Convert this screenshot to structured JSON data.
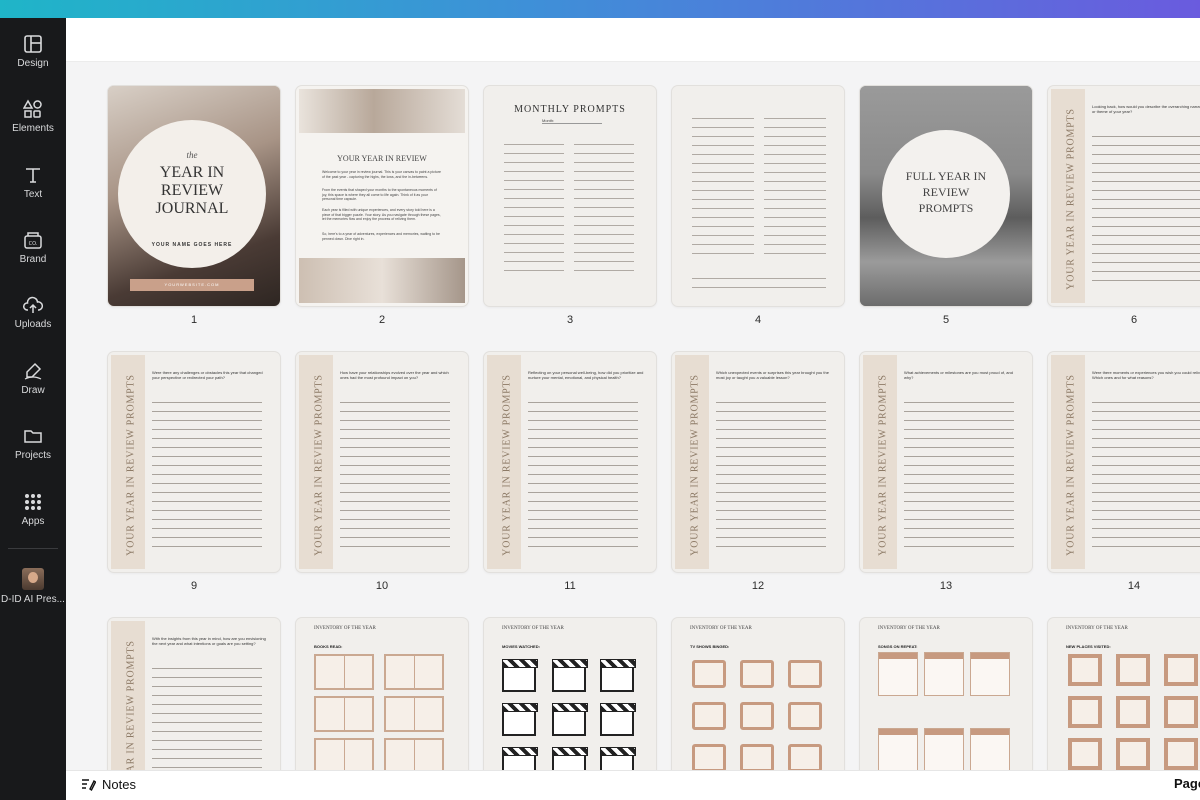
{
  "sidebar": {
    "items": [
      {
        "label": "Design",
        "icon": "layout-icon"
      },
      {
        "label": "Elements",
        "icon": "shapes-icon"
      },
      {
        "label": "Text",
        "icon": "text-icon"
      },
      {
        "label": "Brand",
        "icon": "brand-icon"
      },
      {
        "label": "Uploads",
        "icon": "cloud-upload-icon"
      },
      {
        "label": "Draw",
        "icon": "pen-icon"
      },
      {
        "label": "Projects",
        "icon": "folder-icon"
      },
      {
        "label": "Apps",
        "icon": "apps-grid-icon"
      },
      {
        "label": "D-ID AI Pres...",
        "icon": "avatar"
      }
    ]
  },
  "pages": {
    "p1": {
      "num": "1",
      "the": "the",
      "title": "YEAR IN REVIEW JOURNAL",
      "name": "YOUR NAME GOES HERE",
      "site": "YOURWEBSITE.COM"
    },
    "p2": {
      "num": "2",
      "title": "YOUR YEAR IN REVIEW",
      "body1": "Welcome to your year in review journal. This is your canvas to paint a picture of the past year - capturing the highs, the lows, and the in-betweens.",
      "body2": "From the events that shaped your months to the spontaneous moments of joy, this space is where they all come to life again. Think of it as your personal time capsule.",
      "body3": "Each year is filled with unique experiences, and every story told here is a piece of that bigger puzzle. Your story. As you navigate through these pages, let the memories flow and enjoy the process of reliving them.",
      "body4": "So, here's to a year of adventures, experiences and memories, waiting to be penned down. Dive right in."
    },
    "p3": {
      "num": "3",
      "title": "MONTHLY PROMPTS",
      "month": "Month:"
    },
    "p4": {
      "num": "4"
    },
    "p5": {
      "num": "5",
      "title": "FULL YEAR IN REVIEW PROMPTS"
    },
    "p6": {
      "num": "6",
      "band": "YOUR YEAR IN REVIEW PROMPTS",
      "prompt": "Looking back, how would you describe the overarching narrative or theme of your year?"
    },
    "p9": {
      "num": "9",
      "band": "YOUR YEAR IN REVIEW PROMPTS",
      "prompt": "Were there any challenges or obstacles this year that changed your perspective or redirected your path?"
    },
    "p10": {
      "num": "10",
      "band": "YOUR YEAR IN REVIEW PROMPTS",
      "prompt": "How have your relationships evolved over the year and which ones had the most profound impact on you?"
    },
    "p11": {
      "num": "11",
      "band": "YOUR YEAR IN REVIEW PROMPTS",
      "prompt": "Reflecting on your personal well-being, how did you prioritize and nurture your mental, emotional, and physical health?"
    },
    "p12": {
      "num": "12",
      "band": "YOUR YEAR IN REVIEW PROMPTS",
      "prompt": "Which unexpected events or surprises this year brought you the most joy or taught you a valuable lesson?"
    },
    "p13": {
      "num": "13",
      "band": "YOUR YEAR IN REVIEW PROMPTS",
      "prompt": "What achievements or milestones are you most proud of, and why?"
    },
    "p14": {
      "num": "14",
      "band": "YOUR YEAR IN REVIEW PROMPTS",
      "prompt": "Were there moments or experiences you wish you could relive? Which ones and for what reasons?"
    },
    "p15": {
      "band": "YOUR YEAR IN REVIEW PROMPTS",
      "prompt": "With the insights from this year in mind, how are you envisioning the next year and what intentions or goals are you setting?"
    },
    "p16": {
      "title": "INVENTORY OF THE YEAR",
      "sub": "BOOKS READ:"
    },
    "p17": {
      "title": "INVENTORY OF THE YEAR",
      "sub": "MOVIES WATCHED:"
    },
    "p18": {
      "title": "INVENTORY OF THE YEAR",
      "sub": "TV SHOWS BINGED:"
    },
    "p19": {
      "title": "INVENTORY OF THE YEAR",
      "sub": "SONGS ON REPEAT:"
    },
    "p20": {
      "title": "INVENTORY OF THE YEAR",
      "sub": "NEW PLACES VISITED:"
    }
  },
  "footer": {
    "notes_label": "Notes",
    "page_label": "Page"
  }
}
